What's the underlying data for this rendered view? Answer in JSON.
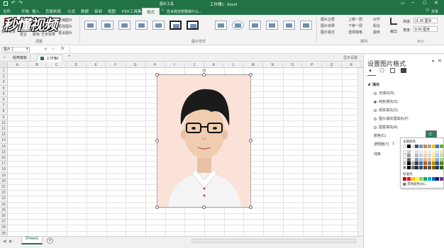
{
  "window": {
    "title": "工作簿1 - Excel",
    "context_tab": "图片工具",
    "user": "共享"
  },
  "watermark": "秒懂视频",
  "menu_tabs": [
    {
      "label": "文件"
    },
    {
      "label": "开始"
    },
    {
      "label": "插入"
    },
    {
      "label": "页面布局"
    },
    {
      "label": "公式"
    },
    {
      "label": "数据"
    },
    {
      "label": "审阅"
    },
    {
      "label": "视图"
    },
    {
      "label": "PDF工具集"
    },
    {
      "label": "格式"
    }
  ],
  "tell_me": "告诉我您想要做什么...",
  "ribbon": {
    "remove_bg": "删除背景",
    "corrections": "更正",
    "color": "颜色",
    "artistic": "艺术效果",
    "compress": "压缩图片",
    "change": "更改图片",
    "reset": "重设图片",
    "adjust_group": "调整",
    "styles_group": "图片样式",
    "border": "图片边框",
    "effects": "图片效果",
    "layout": "图片版式",
    "forward": "上移一层",
    "backward": "下移一层",
    "selection": "选择窗格",
    "align": "对齐",
    "group": "组合",
    "rotate": "旋转",
    "arrange_group": "排列",
    "crop": "裁剪",
    "height_label": "高度:",
    "height": "11.36 厘米",
    "width_label": "宽度:",
    "width": "8.46 厘米",
    "size_group": "大小"
  },
  "formula_bar": {
    "name_box": "图片 1",
    "fx": "fx"
  },
  "doc_tabs": [
    {
      "label": "稻壳模板"
    },
    {
      "label": "工作簿1"
    }
  ],
  "doc_tab_extra": "显示设置",
  "columns": [
    "A",
    "B",
    "C",
    "D",
    "E",
    "F",
    "G",
    "H",
    "I",
    "J",
    "K",
    "L",
    "M",
    "N",
    "O",
    "P",
    "Q",
    "R"
  ],
  "rows": [
    "1",
    "2",
    "3",
    "4",
    "5",
    "6",
    "7",
    "8",
    "9",
    "10",
    "11",
    "12",
    "13",
    "14",
    "15",
    "16",
    "17",
    "18",
    "19",
    "20",
    "21",
    "22",
    "23",
    "24",
    "25",
    "26",
    "27",
    "28",
    "29",
    "30"
  ],
  "sheet_tab": "Sheet1",
  "pane": {
    "title": "设置图片格式",
    "section": "填充",
    "options": [
      {
        "label": "无填充(N)",
        "selected": false
      },
      {
        "label": "纯色填充(S)",
        "selected": true
      },
      {
        "label": "渐变填充(G)",
        "selected": false
      },
      {
        "label": "图片或纹理填充(P)",
        "selected": false
      },
      {
        "label": "图案填充(A)",
        "selected": false
      }
    ],
    "color_label": "颜色(C)",
    "transparency_label": "透明度(T)",
    "transparency_value": "1",
    "border_section": "线条"
  },
  "palette": {
    "theme_label": "主题颜色",
    "standard_label": "标准色",
    "more_label": "其他颜色(M)...",
    "theme_colors": [
      "#ffffff",
      "#000000",
      "#e7e6e6",
      "#44546a",
      "#5b9bd5",
      "#ed7d31",
      "#a5a5a5",
      "#ffc000",
      "#4472c4",
      "#70ad47"
    ],
    "standard_colors": [
      "#c00000",
      "#ff0000",
      "#ffc000",
      "#ffff00",
      "#92d050",
      "#00b050",
      "#00b0f0",
      "#0070c0",
      "#002060",
      "#7030a0"
    ]
  }
}
